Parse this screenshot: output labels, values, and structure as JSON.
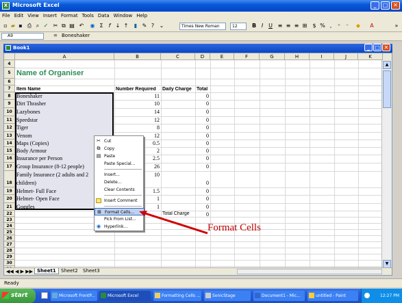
{
  "app": {
    "title": "Microsoft Excel",
    "controls": [
      "_",
      "□",
      "✕"
    ]
  },
  "menu": [
    "File",
    "Edit",
    "View",
    "Insert",
    "Format",
    "Tools",
    "Data",
    "Window",
    "Help"
  ],
  "toolbar": {
    "font_name": "Times New Roman",
    "font_size": "12",
    "bold": "B",
    "italic": "I",
    "underline": "U"
  },
  "formula_bar": {
    "name_box": "A9",
    "content": "Boneshaker"
  },
  "workbook": {
    "title": "Book1",
    "columns": [
      "A",
      "B",
      "C",
      "D",
      "E",
      "F",
      "G",
      "H",
      "I",
      "J",
      "K"
    ],
    "rows": [
      "4",
      "5",
      "6",
      "7",
      "8",
      "9",
      "10",
      "11",
      "12",
      "13",
      "14",
      "15",
      "16",
      "17",
      "18",
      "19",
      "20",
      "21",
      "22",
      "23",
      "24",
      "25",
      "26",
      "27",
      "28",
      "29",
      "30",
      "31"
    ],
    "heading": "Name of Organiser",
    "headers": [
      "Item Name",
      "Number Required",
      "Daily Charge",
      "Total"
    ],
    "items": [
      {
        "name": "Boneshaker",
        "qty": "11",
        "total": "0"
      },
      {
        "name": "Dirt Thrasher",
        "qty": "10",
        "total": "0"
      },
      {
        "name": "Lazybones",
        "qty": "14",
        "total": "0"
      },
      {
        "name": "Speedstar",
        "qty": "12",
        "total": "0"
      },
      {
        "name": "Tiger",
        "qty": "8",
        "total": "0"
      },
      {
        "name": "Venom",
        "qty": "12",
        "total": "0"
      },
      {
        "name": "Maps (Copies)",
        "qty": "0.5",
        "total": "0"
      },
      {
        "name": "Body Armour",
        "qty": "2",
        "total": "0"
      },
      {
        "name": "Insurance per Person",
        "qty": "2.5",
        "total": "0"
      },
      {
        "name": "Group Insurance (8-12 people)",
        "qty": "26",
        "total": "0"
      },
      {
        "name": "Family Insurance (2 adults and 2",
        "name2": "children)",
        "qty": "10",
        "total": "0"
      },
      {
        "name": "Helmet- Full Face",
        "qty": "1.5",
        "total": "0"
      },
      {
        "name": "Helmet- Open Face",
        "qty": "1",
        "total": "0"
      },
      {
        "name": "Goggles",
        "qty": "1",
        "total": "0"
      }
    ],
    "total_charge_label": "Total Charge",
    "total_charge_value": "0",
    "sheets": [
      "Sheet1",
      "Sheet2",
      "Sheet3"
    ]
  },
  "context_menu": [
    {
      "label": "Cut",
      "icon": "scissors-icon"
    },
    {
      "label": "Copy",
      "icon": "copy-icon"
    },
    {
      "label": "Paste",
      "icon": "paste-icon"
    },
    {
      "label": "Paste Special..."
    },
    {
      "label": "Insert..."
    },
    {
      "label": "Delete..."
    },
    {
      "label": "Clear Contents"
    },
    {
      "label": "Insert Comment",
      "icon": "comment-icon"
    },
    {
      "label": "Format Cells...",
      "icon": "format-cells-icon"
    },
    {
      "label": "Pick From List..."
    },
    {
      "label": "Hyperlink...",
      "icon": "hyperlink-icon"
    }
  ],
  "annotation": "Format Cells",
  "status": "Ready",
  "taskbar": {
    "start": "start",
    "tasks": [
      "Microsoft FrontP...",
      "Microsoft Excel",
      "Formatting Cells ...",
      "SonicStage",
      "Document1 - Mic...",
      "untitled - Paint"
    ],
    "clock": "12:27 PM"
  }
}
